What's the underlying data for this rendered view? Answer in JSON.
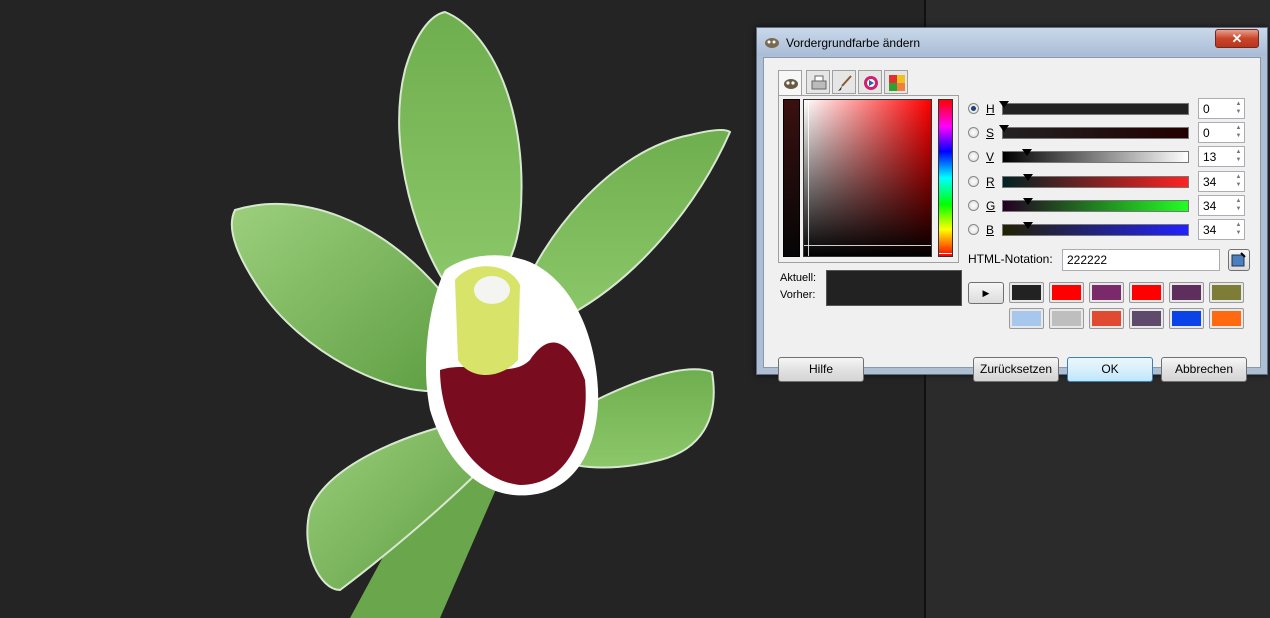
{
  "dialog": {
    "title": "Vordergrundfarbe ändern"
  },
  "selector_tabs": [
    "gimp-selector-icon",
    "cmyk-printer-icon",
    "watercolor-brush-icon",
    "color-wheel-icon",
    "palette-scales-icon"
  ],
  "compare": {
    "current_label": "Aktuell:",
    "previous_label": "Vorher:",
    "current_color": "#222222"
  },
  "channels": [
    {
      "label": "H",
      "value": "0",
      "selected": true
    },
    {
      "label": "S",
      "value": "0",
      "selected": false
    },
    {
      "label": "V",
      "value": "13",
      "selected": false
    },
    {
      "label": "R",
      "value": "34",
      "selected": false
    },
    {
      "label": "G",
      "value": "34",
      "selected": false
    },
    {
      "label": "B",
      "value": "34",
      "selected": false
    }
  ],
  "html_notation": {
    "label": "HTML-Notation:",
    "value": "222222"
  },
  "history_colors": [
    "#222222",
    "#ff0000",
    "#7a2a6a",
    "#ff0000",
    "#5e2e5c",
    "#7d7d38",
    "#a7c8ec",
    "#bebebe",
    "#e04a30",
    "#5e4a6a",
    "#0a44e8",
    "#ff6a10"
  ],
  "buttons": {
    "help": "Hilfe",
    "reset": "Zurücksetzen",
    "ok": "OK",
    "cancel": "Abbrechen"
  },
  "colors": {
    "canvas_bg": "#242424",
    "dialog_frame": "#aebfd4"
  }
}
